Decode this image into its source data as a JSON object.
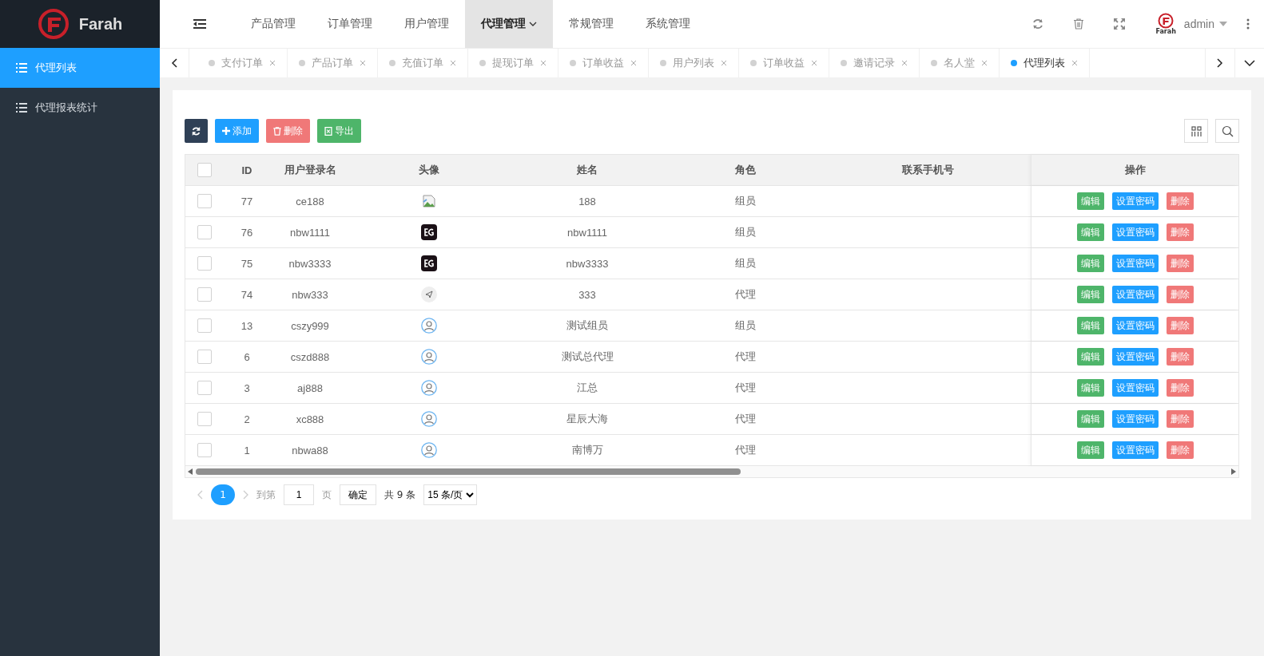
{
  "brand": {
    "name": "Farah",
    "small_logo_text": "Farah"
  },
  "sidebar": {
    "items": [
      {
        "label": "代理列表",
        "selected": true
      },
      {
        "label": "代理报表统计",
        "selected": false
      }
    ]
  },
  "top_nav": {
    "items": [
      {
        "label": "产品管理",
        "selected": false,
        "has_dropdown": false
      },
      {
        "label": "订单管理",
        "selected": false,
        "has_dropdown": false
      },
      {
        "label": "用户管理",
        "selected": false,
        "has_dropdown": false
      },
      {
        "label": "代理管理",
        "selected": true,
        "has_dropdown": true
      },
      {
        "label": "常规管理",
        "selected": false,
        "has_dropdown": false
      },
      {
        "label": "系统管理",
        "selected": false,
        "has_dropdown": false
      }
    ],
    "user": "admin"
  },
  "tabs": [
    {
      "label": "支付订单",
      "selected": false
    },
    {
      "label": "产品订单",
      "selected": false
    },
    {
      "label": "充值订单",
      "selected": false
    },
    {
      "label": "提现订单",
      "selected": false
    },
    {
      "label": "订单收益",
      "selected": false
    },
    {
      "label": "用户列表",
      "selected": false
    },
    {
      "label": "订单收益",
      "selected": false
    },
    {
      "label": "邀请记录",
      "selected": false
    },
    {
      "label": "名人堂",
      "selected": false
    },
    {
      "label": "代理列表",
      "selected": true
    }
  ],
  "toolbar": [
    {
      "kind": "refresh"
    },
    {
      "kind": "add",
      "label": "添加"
    },
    {
      "kind": "delete",
      "label": "删除"
    },
    {
      "kind": "export",
      "label": "导出"
    }
  ],
  "table": {
    "columns": [
      "ID",
      "用户登录名",
      "头像",
      "姓名",
      "角色",
      "联系手机号",
      "操作"
    ],
    "rows": [
      {
        "id": "77",
        "login": "ce188",
        "kind": "broken",
        "name": "188",
        "role": "组员",
        "checked": false,
        "actions": [
          {
            "kind": "edit",
            "label": "编辑"
          },
          {
            "kind": "password",
            "label": "设置密码"
          },
          {
            "kind": "delete",
            "label": "删除"
          }
        ]
      },
      {
        "id": "76",
        "login": "nbw1111",
        "kind": "eg",
        "name": "nbw1111",
        "role": "组员",
        "checked": false,
        "actions": [
          {
            "kind": "edit",
            "label": "编辑"
          },
          {
            "kind": "password",
            "label": "设置密码"
          },
          {
            "kind": "delete",
            "label": "删除"
          }
        ]
      },
      {
        "id": "75",
        "login": "nbw3333",
        "kind": "eg",
        "name": "nbw3333",
        "role": "组员",
        "checked": false,
        "actions": [
          {
            "kind": "edit",
            "label": "编辑"
          },
          {
            "kind": "password",
            "label": "设置密码"
          },
          {
            "kind": "delete",
            "label": "删除"
          }
        ]
      },
      {
        "id": "74",
        "login": "nbw333",
        "kind": "plane",
        "name": "333",
        "role": "代理",
        "checked": false,
        "actions": [
          {
            "kind": "edit",
            "label": "编辑"
          },
          {
            "kind": "password",
            "label": "设置密码"
          },
          {
            "kind": "delete",
            "label": "删除"
          }
        ]
      },
      {
        "id": "13",
        "login": "cszy999",
        "kind": "user",
        "name": "测试组员",
        "role": "组员",
        "checked": false,
        "actions": [
          {
            "kind": "edit",
            "label": "编辑"
          },
          {
            "kind": "password",
            "label": "设置密码"
          },
          {
            "kind": "delete",
            "label": "删除"
          }
        ]
      },
      {
        "id": "6",
        "login": "cszd888",
        "kind": "user",
        "name": "测试总代理",
        "role": "代理",
        "checked": false,
        "actions": [
          {
            "kind": "edit",
            "label": "编辑"
          },
          {
            "kind": "password",
            "label": "设置密码"
          },
          {
            "kind": "delete",
            "label": "删除"
          }
        ]
      },
      {
        "id": "3",
        "login": "aj888",
        "kind": "user",
        "name": "江总",
        "role": "代理",
        "checked": false,
        "actions": [
          {
            "kind": "edit",
            "label": "编辑"
          },
          {
            "kind": "password",
            "label": "设置密码"
          },
          {
            "kind": "delete",
            "label": "删除"
          }
        ]
      },
      {
        "id": "2",
        "login": "xc888",
        "kind": "user",
        "name": "星辰大海",
        "role": "代理",
        "checked": false,
        "actions": [
          {
            "kind": "edit",
            "label": "编辑"
          },
          {
            "kind": "password",
            "label": "设置密码"
          },
          {
            "kind": "delete",
            "label": "删除"
          }
        ]
      },
      {
        "id": "1",
        "login": "nbwa88",
        "kind": "user",
        "name": "南博万",
        "role": "代理",
        "checked": false,
        "actions": [
          {
            "kind": "edit",
            "label": "编辑"
          },
          {
            "kind": "password",
            "label": "设置密码"
          },
          {
            "kind": "delete",
            "label": "删除"
          }
        ]
      }
    ],
    "all_checked": false
  },
  "pagination": {
    "pages": [
      {
        "label": "1",
        "selected": true
      }
    ],
    "goto_label": "到第",
    "goto_value": "1",
    "page_unit": "页",
    "confirm": "确定",
    "total": "共 9 条",
    "page_size": "15 条/页"
  }
}
